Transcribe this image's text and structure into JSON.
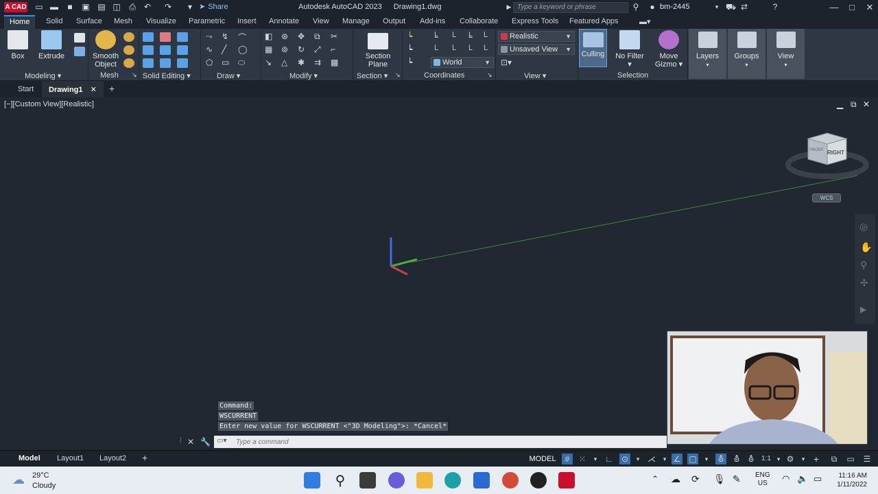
{
  "titlebar": {
    "app_badge": "A CAD",
    "share_label": "Share",
    "app_name": "Autodesk AutoCAD 2023",
    "doc_name": "Drawing1.dwg",
    "search_placeholder": "Type a keyword or phrase",
    "user": "bm-2445"
  },
  "ribbon_tabs": [
    "Home",
    "Solid",
    "Surface",
    "Mesh",
    "Visualize",
    "Parametric",
    "Insert",
    "Annotate",
    "View",
    "Manage",
    "Output",
    "Add-ins",
    "Collaborate",
    "Express Tools",
    "Featured Apps"
  ],
  "ribbon": {
    "box": "Box",
    "extrude": "Extrude",
    "smooth_object_1": "Smooth",
    "smooth_object_2": "Object",
    "section_plane_1": "Section",
    "section_plane_2": "Plane",
    "visual_style": "Realistic",
    "saved_view": "Unsaved View",
    "coord_system": "World",
    "culling": "Culling",
    "no_filter": "No Filter",
    "move_gizmo_1": "Move",
    "move_gizmo_2": "Gizmo",
    "layers": "Layers",
    "groups": "Groups",
    "view": "View",
    "panels": {
      "modeling": "Modeling",
      "mesh": "Mesh",
      "solid_editing": "Solid Editing",
      "draw": "Draw",
      "modify": "Modify",
      "section": "Section",
      "coordinates": "Coordinates",
      "view": "View",
      "selection": "Selection"
    }
  },
  "file_tabs": {
    "start": "Start",
    "active": "Drawing1"
  },
  "viewport": {
    "label": "[−][Custom View][Realistic]",
    "viewcube_face": "RIGHT",
    "viewcube_top": "FRONT",
    "wcs": "WCS"
  },
  "command": {
    "history": [
      "Command:",
      "WSCURRENT",
      "Enter new value for WSCURRENT <\"3D Modeling\">: *Cancel*"
    ],
    "placeholder": "Type a command"
  },
  "status": {
    "layouts": [
      "Model",
      "Layout1",
      "Layout2"
    ],
    "model": "MODEL",
    "scale": "1:1"
  },
  "taskbar": {
    "temp": "29°C",
    "condition": "Cloudy",
    "lang_1": "ENG",
    "lang_2": "US",
    "time": "11:16 AM",
    "date": "1/11/2022"
  },
  "colors": {
    "accent": "#3a8ee6",
    "badge": "#c8102e",
    "ribbon": "#2e3844",
    "viewport": "#222831"
  }
}
